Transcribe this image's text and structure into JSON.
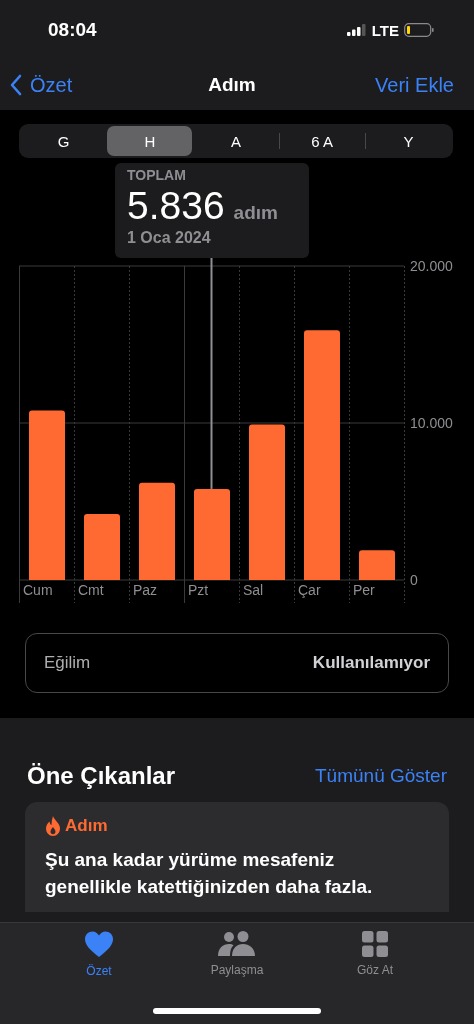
{
  "status_bar": {
    "time": "08:04",
    "network": "LTE"
  },
  "nav": {
    "back": "Özet",
    "title": "Adım",
    "action": "Veri Ekle"
  },
  "range_tabs": [
    {
      "label": "G",
      "selected": false
    },
    {
      "label": "H",
      "selected": true
    },
    {
      "label": "A",
      "selected": false
    },
    {
      "label": "6 A",
      "selected": false
    },
    {
      "label": "Y",
      "selected": false
    }
  ],
  "tooltip": {
    "label": "TOPLAM",
    "value": "5.836",
    "unit": "adım",
    "date": "1 Oca 2024"
  },
  "chart": {
    "chart_data": {
      "type": "bar",
      "categories": [
        "Cum",
        "Cmt",
        "Paz",
        "Pzt",
        "Sal",
        "Çar",
        "Per"
      ],
      "series": [
        {
          "color": "#ff6a33",
          "values": [
            10800,
            4200,
            6200,
            5800,
            9900,
            15900,
            1900
          ]
        }
      ],
      "ylim": [
        0,
        20000
      ],
      "yticks": [
        0,
        {
          "value": 10000,
          "label": "10.000"
        },
        {
          "value": 20000,
          "label": "20.000"
        }
      ]
    }
  },
  "trend": {
    "label": "Eğilim",
    "value": "Kullanılamıyor"
  },
  "highlights": {
    "title": "Öne Çıkanlar",
    "link": "Tümünü Göster",
    "card": {
      "category": "Adım",
      "text": "Şu ana kadar yürüme mesafeniz genellikle katettiğinizden daha fazla."
    }
  },
  "tab_bar": [
    {
      "label": "Özet",
      "selected": true
    },
    {
      "label": "Paylaşma",
      "selected": false
    },
    {
      "label": "Göz At",
      "selected": false
    }
  ]
}
